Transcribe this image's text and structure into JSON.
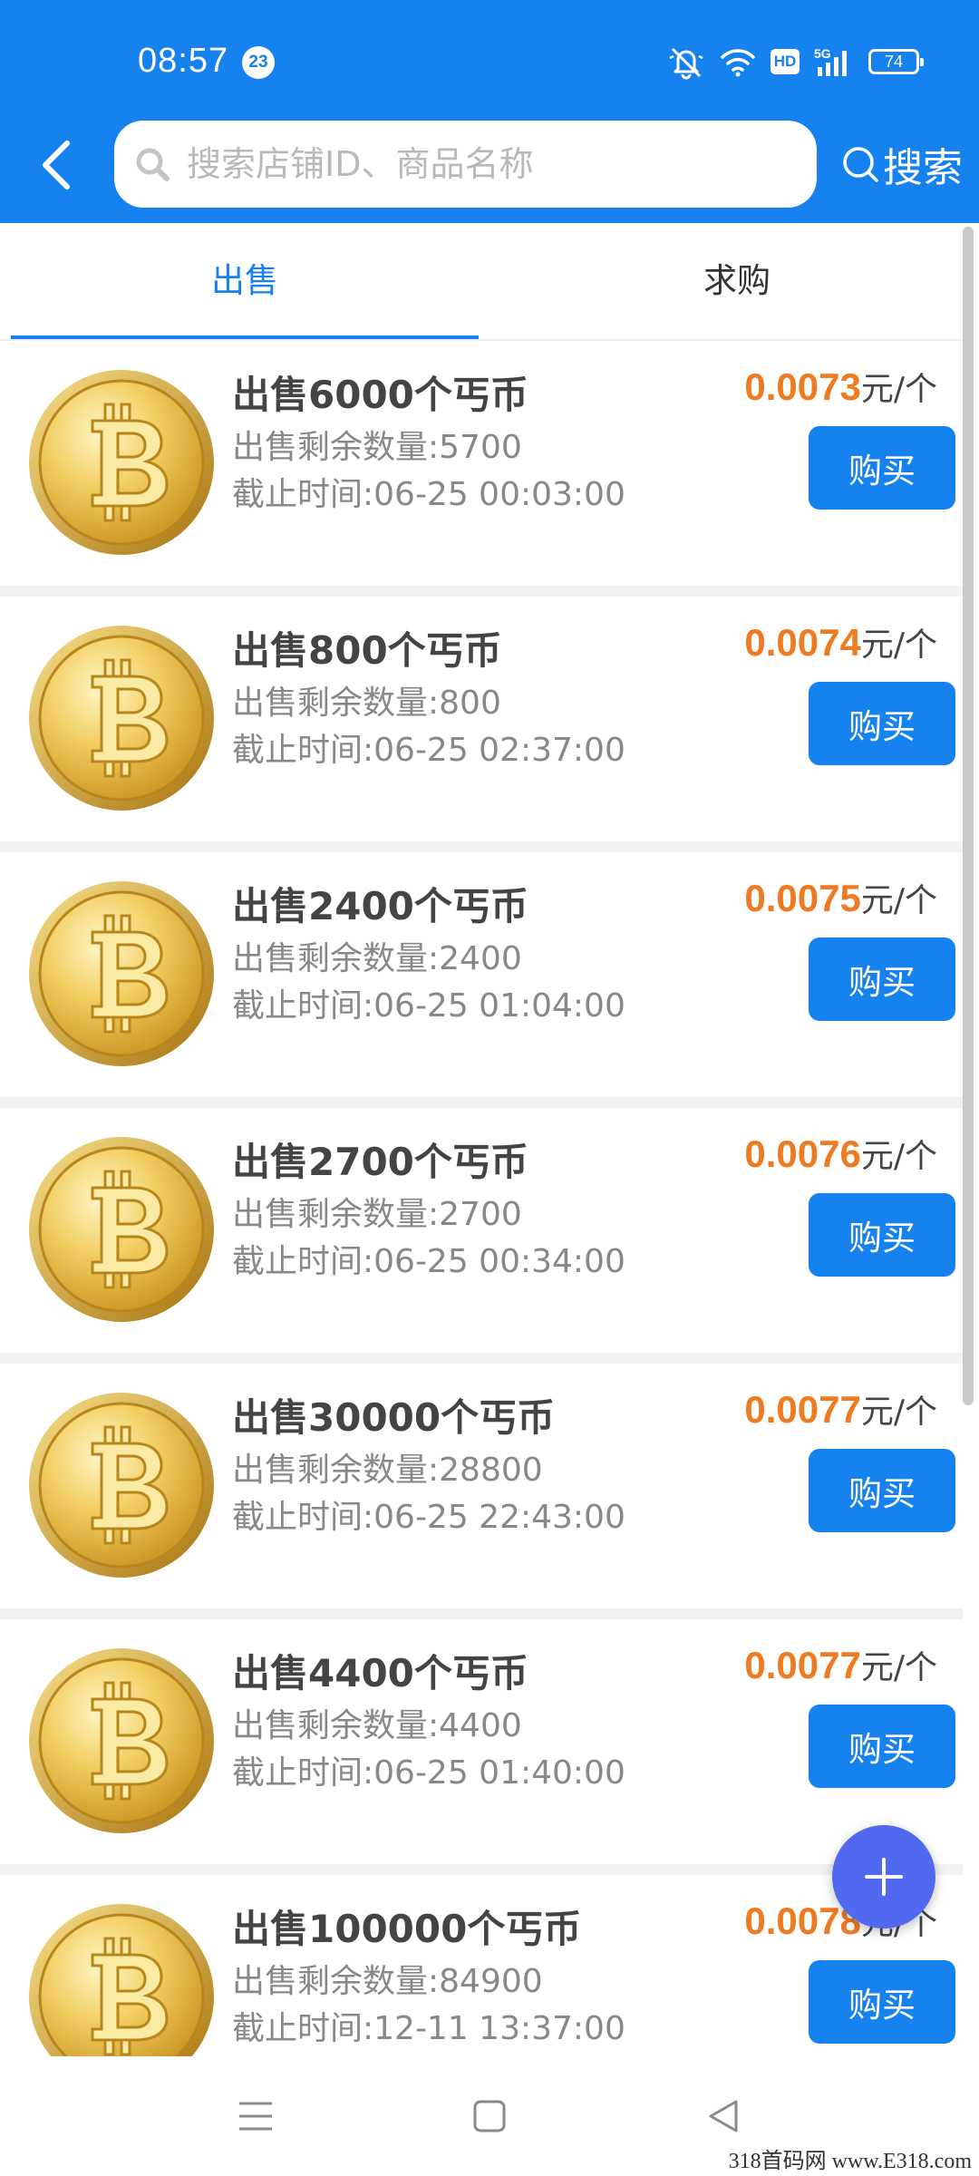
{
  "status_bar": {
    "time": "08:57",
    "notification_count": "23",
    "icons": [
      "mute-bell-icon",
      "wifi-icon",
      "hd-icon",
      "signal-5g-icon",
      "battery-icon"
    ],
    "hd": "HD",
    "network": "5G",
    "battery": "74"
  },
  "search": {
    "placeholder": "搜索店铺ID、商品名称",
    "button_label": "搜索"
  },
  "tabs": [
    {
      "label": "出售",
      "active": true
    },
    {
      "label": "求购",
      "active": false
    }
  ],
  "listings": [
    {
      "title": "出售6000个丐币",
      "remaining": "出售剩余数量:5700",
      "deadline": "截止时间:06-25 00:03:00",
      "price": "0.0073",
      "unit": "元/个",
      "buy_label": "购买"
    },
    {
      "title": "出售800个丐币",
      "remaining": "出售剩余数量:800",
      "deadline": "截止时间:06-25 02:37:00",
      "price": "0.0074",
      "unit": "元/个",
      "buy_label": "购买"
    },
    {
      "title": "出售2400个丐币",
      "remaining": "出售剩余数量:2400",
      "deadline": "截止时间:06-25 01:04:00",
      "price": "0.0075",
      "unit": "元/个",
      "buy_label": "购买"
    },
    {
      "title": "出售2700个丐币",
      "remaining": "出售剩余数量:2700",
      "deadline": "截止时间:06-25 00:34:00",
      "price": "0.0076",
      "unit": "元/个",
      "buy_label": "购买"
    },
    {
      "title": "出售30000个丐币",
      "remaining": "出售剩余数量:28800",
      "deadline": "截止时间:06-25 22:43:00",
      "price": "0.0077",
      "unit": "元/个",
      "buy_label": "购买"
    },
    {
      "title": "出售4400个丐币",
      "remaining": "出售剩余数量:4400",
      "deadline": "截止时间:06-25 01:40:00",
      "price": "0.0077",
      "unit": "元/个",
      "buy_label": "购买"
    },
    {
      "title": "出售100000个丐币",
      "remaining": "出售剩余数量:84900",
      "deadline": "截止时间:12-11 13:37:00",
      "price": "0.0078",
      "unit": "元/个",
      "buy_label": "购买"
    }
  ],
  "watermark": "318首码网 www.E318.com",
  "colors": {
    "primary": "#1682f0",
    "price": "#ee7a22",
    "fab": "#5168f0",
    "coin_gold": "#e2b43a"
  }
}
